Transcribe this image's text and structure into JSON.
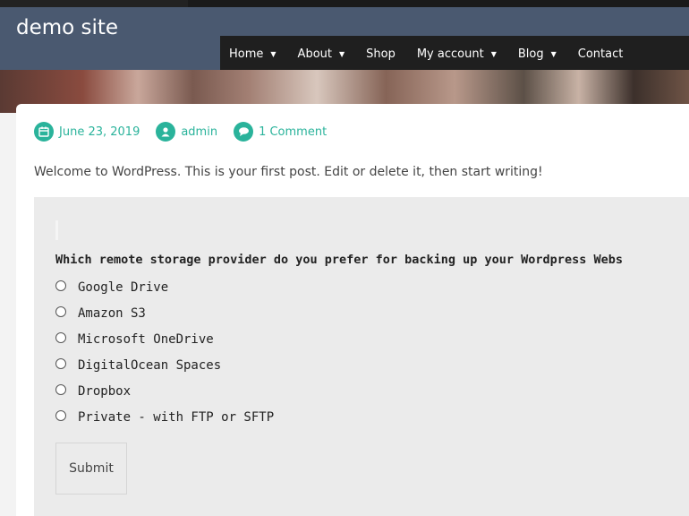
{
  "site": {
    "title": "demo site"
  },
  "nav": {
    "items": [
      {
        "label": "Home",
        "has_dropdown": true
      },
      {
        "label": "About",
        "has_dropdown": true
      },
      {
        "label": "Shop",
        "has_dropdown": false
      },
      {
        "label": "My account",
        "has_dropdown": true
      },
      {
        "label": "Blog",
        "has_dropdown": true
      },
      {
        "label": "Contact",
        "has_dropdown": false
      }
    ]
  },
  "post": {
    "meta": {
      "date": "June 23, 2019",
      "author": "admin",
      "comments": "1 Comment",
      "accent_color": "#2ab39b"
    },
    "excerpt": "Welcome to WordPress. This is your first post. Edit or delete it, then start writing!"
  },
  "poll": {
    "question": "Which remote storage provider do you prefer for backing up your Wordpress Webs",
    "options": [
      "Google Drive",
      "Amazon S3",
      "Microsoft OneDrive",
      "DigitalOcean Spaces",
      "Dropbox",
      "Private - with FTP or SFTP"
    ],
    "submit_label": "Submit"
  }
}
